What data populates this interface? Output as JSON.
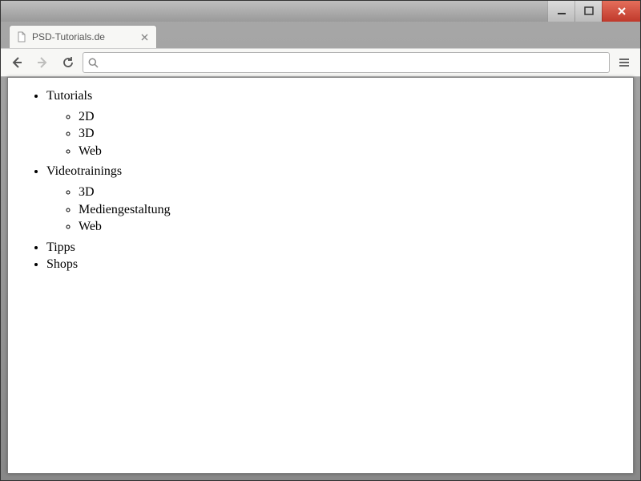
{
  "window": {
    "tab_title": "PSD-Tutorials.de",
    "address": ""
  },
  "nav": {
    "items": [
      {
        "label": "Tutorials",
        "children": [
          {
            "label": "2D"
          },
          {
            "label": "3D"
          },
          {
            "label": "Web"
          }
        ]
      },
      {
        "label": "Videotrainings",
        "children": [
          {
            "label": "3D"
          },
          {
            "label": "Mediengestaltung"
          },
          {
            "label": "Web"
          }
        ]
      },
      {
        "label": "Tipps"
      },
      {
        "label": "Shops"
      }
    ]
  }
}
